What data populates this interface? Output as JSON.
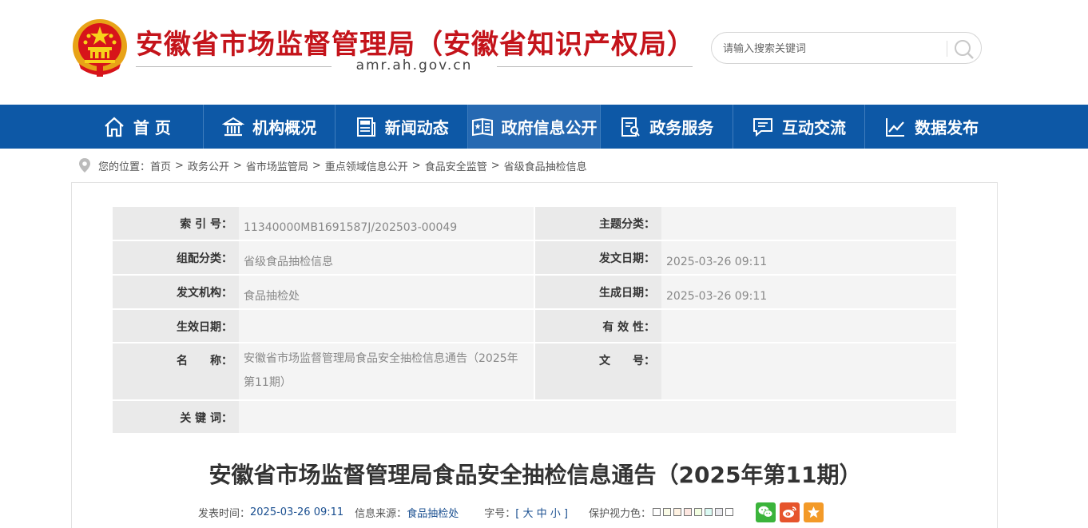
{
  "header": {
    "site_title": "安徽省市场监督管理局（安徽省知识产权局）",
    "domain": "amr.ah.gov.cn",
    "search_placeholder": "请输入搜索关键词"
  },
  "nav": {
    "items": [
      {
        "label": "首 页",
        "icon": "home-icon"
      },
      {
        "label": "机构概况",
        "icon": "institution-icon"
      },
      {
        "label": "新闻动态",
        "icon": "news-icon"
      },
      {
        "label": "政府信息公开",
        "icon": "open-info-icon"
      },
      {
        "label": "政务服务",
        "icon": "service-icon"
      },
      {
        "label": "互动交流",
        "icon": "chat-icon"
      },
      {
        "label": "数据发布",
        "icon": "chart-icon"
      }
    ],
    "active_index": 3
  },
  "breadcrumb": {
    "prefix": "您的位置：",
    "items": [
      "首页",
      "政务公开",
      "省市场监管局",
      "重点领域信息公开",
      "食品安全监管",
      "省级食品抽检信息"
    ],
    "separator": ">"
  },
  "meta": {
    "index_no_label": "索 引 号：",
    "index_no": "11340000MB1691587J/202503-00049",
    "topic_label": "主题分类：",
    "topic": "",
    "group_label": "组配分类：",
    "group": "省级食品抽检信息",
    "publish_date_label": "发文日期：",
    "publish_date": "2025-03-26 09:11",
    "issuer_label": "发文机构：",
    "issuer": "食品抽检处",
    "created_date_label": "生成日期：",
    "created_date": "2025-03-26 09:11",
    "effective_date_label": "生效日期：",
    "effective_date": "",
    "validity_label": "有 效 性：",
    "validity": "",
    "name_label": "名　　称：",
    "name": "安徽省市场监督管理局食品安全抽检信息通告（2025年第11期）",
    "doc_no_label": "文　　号：",
    "doc_no": "",
    "keywords_label": "关 键 词：",
    "keywords": ""
  },
  "article": {
    "title": "安徽省市场监督管理局食品安全抽检信息通告（2025年第11期）",
    "published_label": "发表时间：",
    "published": "2025-03-26 09:11",
    "source_label": "信息来源：",
    "source": "食品抽检处",
    "font_size_label": "字号：",
    "font_size_open": "[",
    "font_large": "大",
    "font_medium": "中",
    "font_small": "小",
    "font_size_close": "]",
    "eye_care_label": "保护视力色：",
    "eye_colors": [
      "#ffffff",
      "#fafbe6",
      "#fff2e2",
      "#fde6e0",
      "#f3ffe1",
      "#dafaf3",
      "#eaeaef",
      "#ffffff"
    ]
  },
  "share": [
    {
      "name": "wechat-icon",
      "color": "#3bb43b"
    },
    {
      "name": "weibo-icon",
      "color": "#e6542c"
    },
    {
      "name": "favorite-icon",
      "color": "#f39a28"
    }
  ],
  "colors": {
    "title_red": "#c4141b",
    "nav_blue": "#0d58a6",
    "nav_active": "#2669b2"
  }
}
